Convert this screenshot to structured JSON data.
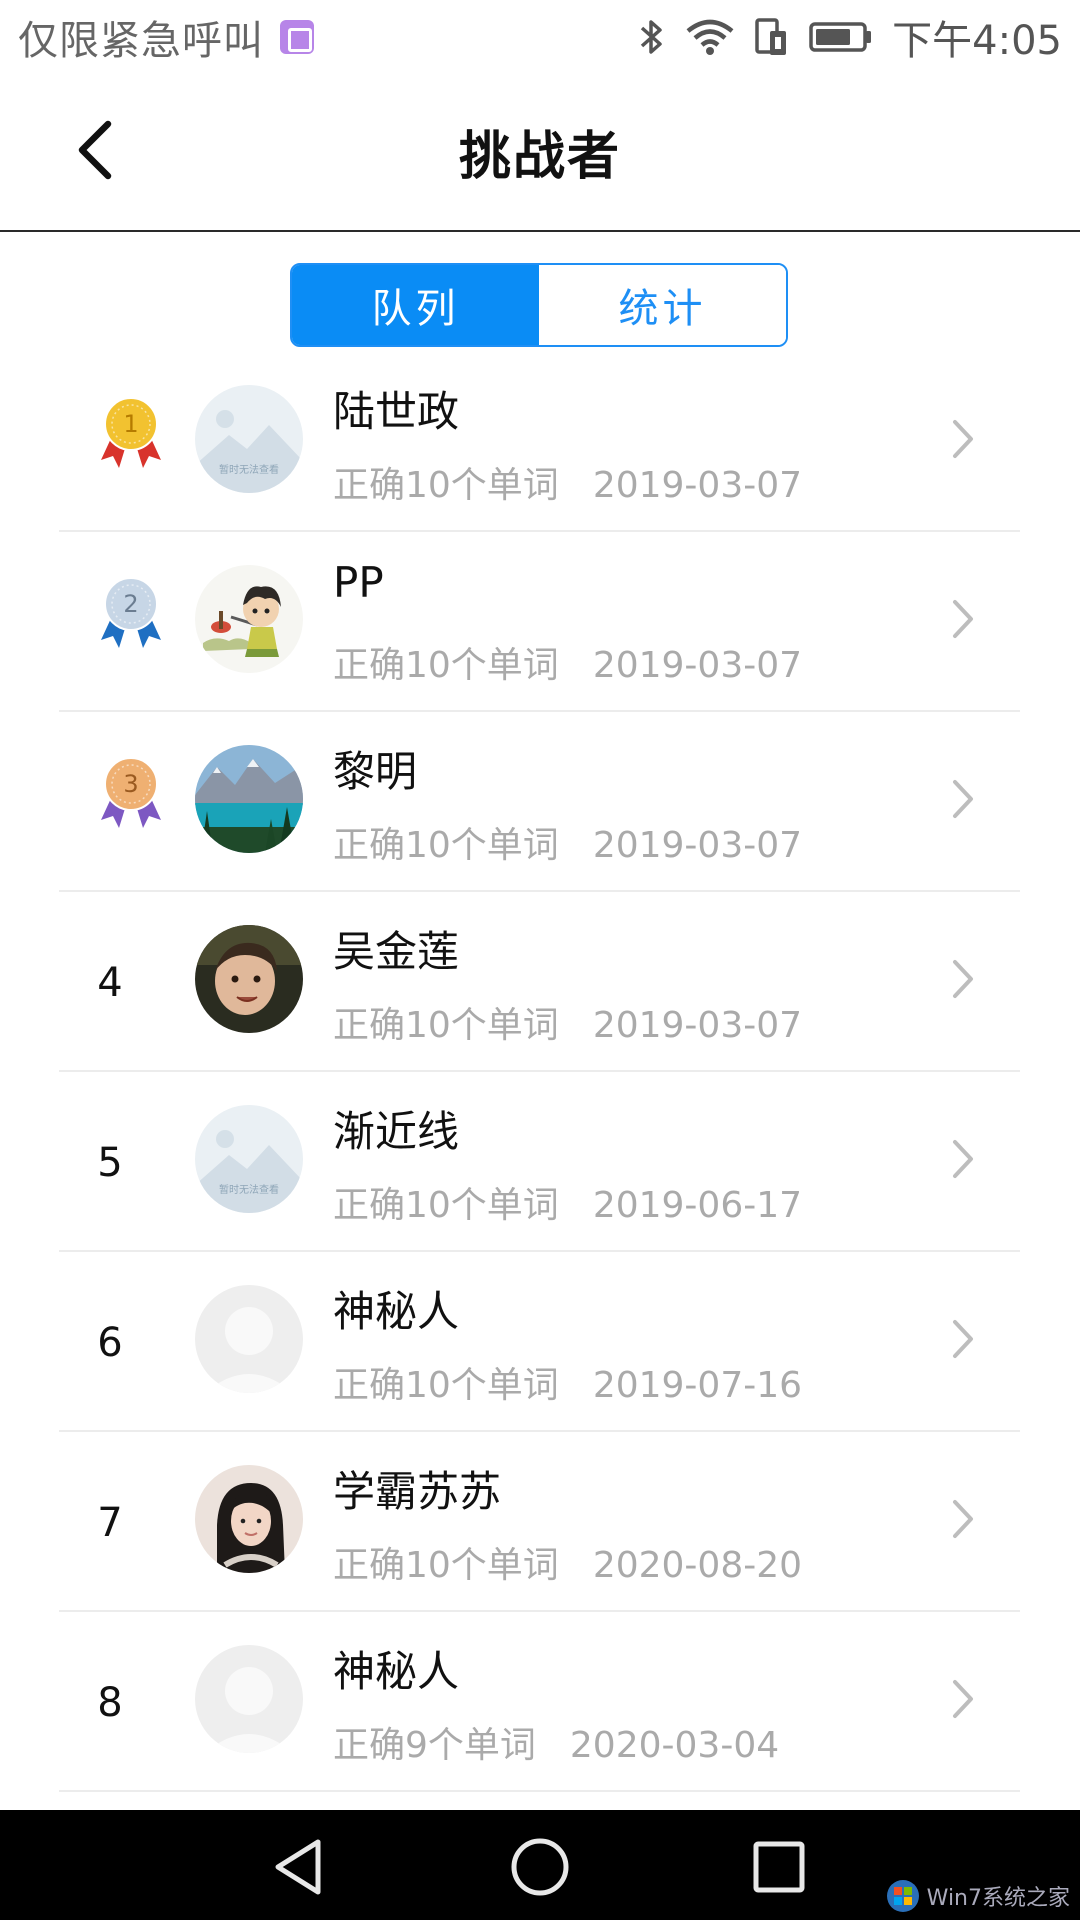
{
  "status_bar": {
    "carrier": "仅限紧急呼叫",
    "time": "下午4:05"
  },
  "header": {
    "title": "挑战者"
  },
  "tabs": [
    {
      "label": "队列",
      "active": true
    },
    {
      "label": "统计",
      "active": false
    }
  ],
  "colors": {
    "accent": "#0a8cf5",
    "muted_text": "#aaaaaa",
    "gold": "#f2c230",
    "silver": "#c7d6e6",
    "bronze": "#efb072",
    "ribbon_red": "#d8332c",
    "ribbon_blue": "#1f6fc2",
    "ribbon_purple": "#7d58c2"
  },
  "rows": [
    {
      "rank": "1",
      "name": "陆世政",
      "correct": "正确10个单词",
      "date": "2019-03-07",
      "avatar": "placeholder-image"
    },
    {
      "rank": "2",
      "name": "PP",
      "correct": "正确10个单词",
      "date": "2019-03-07",
      "avatar": "cartoon-boy"
    },
    {
      "rank": "3",
      "name": "黎明",
      "correct": "正确10个单词",
      "date": "2019-03-07",
      "avatar": "mountain-lake"
    },
    {
      "rank": "4",
      "name": "吴金莲",
      "correct": "正确10个单词",
      "date": "2019-03-07",
      "avatar": "baby-photo"
    },
    {
      "rank": "5",
      "name": "渐近线",
      "correct": "正确10个单词",
      "date": "2019-06-17",
      "avatar": "placeholder-image"
    },
    {
      "rank": "6",
      "name": "神秘人",
      "correct": "正确10个单词",
      "date": "2019-07-16",
      "avatar": "default-user"
    },
    {
      "rank": "7",
      "name": "学霸苏苏",
      "correct": "正确10个单词",
      "date": "2020-08-20",
      "avatar": "girl-photo"
    },
    {
      "rank": "8",
      "name": "神秘人",
      "correct": "正确9个单词",
      "date": "2020-03-04",
      "avatar": "default-user"
    }
  ],
  "placeholder_caption": "暂时无法查看",
  "watermark": "Win7系统之家"
}
